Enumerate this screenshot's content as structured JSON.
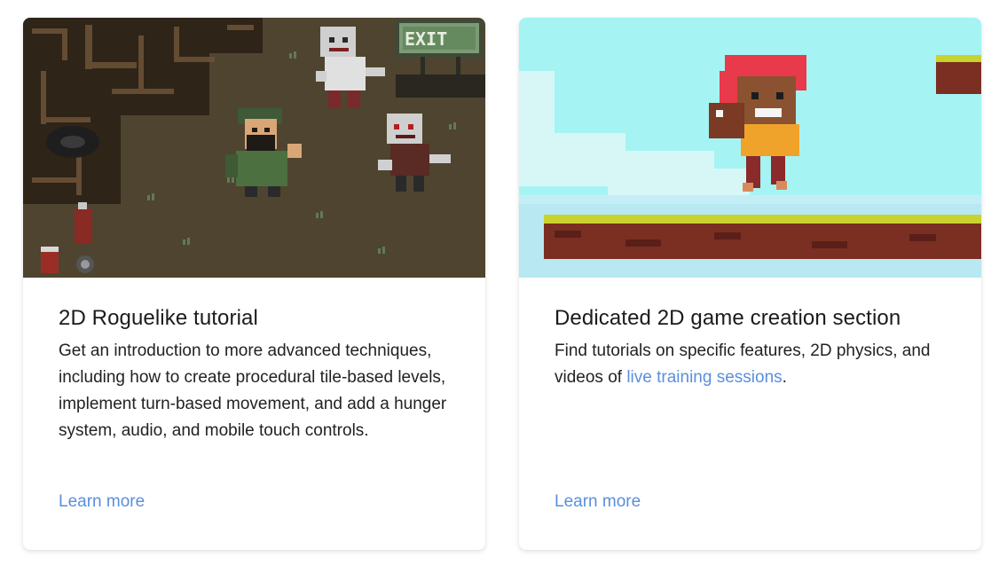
{
  "colors": {
    "link": "#5a8fdc",
    "title": "#1b1b1b",
    "text": "#222222",
    "card_bg": "#ffffff"
  },
  "cards": [
    {
      "title": "2D Roguelike tutorial",
      "description": "Get an introduction to more advanced techniques, including how to create procedural tile-based levels, implement turn-based movement, and add a hunger system, audio, and mobile touch controls.",
      "link_label": "Learn more",
      "image": {
        "sign_text": "EXIT"
      }
    },
    {
      "title": "Dedicated 2D game creation section",
      "description_before": "Find tutorials on specific features, 2D physics, and videos of ",
      "description_link": "live training sessions",
      "description_after": ".",
      "link_label": "Learn more"
    }
  ]
}
